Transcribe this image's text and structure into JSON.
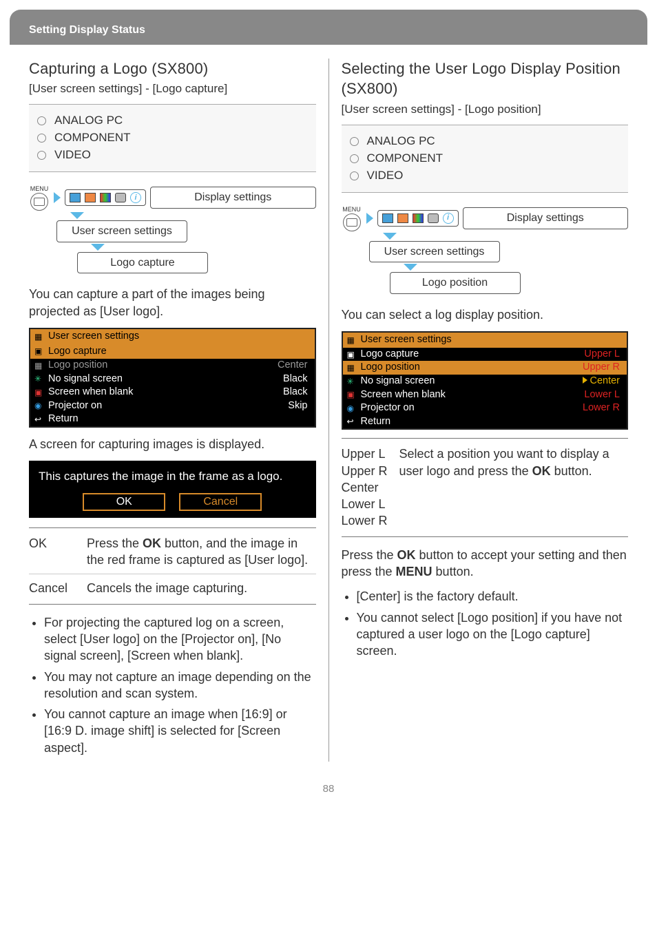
{
  "header": {
    "title": "Setting Display Status"
  },
  "left": {
    "title": "Capturing a Logo (SX800)",
    "path": "[User screen settings] - [Logo capture]",
    "sources": [
      "ANALOG PC",
      "COMPONENT",
      "VIDEO"
    ],
    "bc": {
      "menu": "MENU",
      "top": "Display settings",
      "mid": "User screen settings",
      "leaf": "Logo capture"
    },
    "para1": "You can capture a part of the images being projected as [User logo].",
    "ui1": {
      "header": "User screen settings",
      "sel": "Logo capture",
      "rows": [
        {
          "l": "Logo position",
          "r": "Center"
        },
        {
          "l": "No signal screen",
          "r": "Black"
        },
        {
          "l": "Screen when blank",
          "r": "Black"
        },
        {
          "l": "Projector on",
          "r": "Skip"
        }
      ],
      "return": "Return"
    },
    "para2": "A screen for capturing images is displayed.",
    "dialog": {
      "msg": "This captures the image in the frame as a logo.",
      "ok": "OK",
      "cancel": "Cancel"
    },
    "defs": {
      "ok": {
        "k": "OK",
        "v1": "Press the ",
        "v2": "OK",
        "v3": " button, and the image in the red frame is captured as [User logo]."
      },
      "cancel": {
        "k": "Cancel",
        "v": "Cancels the image capturing."
      }
    },
    "bullets": [
      "For projecting the captured log on a screen, select [User logo] on the [Projector on], [No signal screen], [Screen when blank].",
      "You may not capture an image depending on the resolution and scan system.",
      "You cannot capture an image when [16:9] or [16:9 D. image shift] is selected for [Screen aspect]."
    ]
  },
  "right": {
    "title": "Selecting the User Logo Display Position (SX800)",
    "path": "[User screen settings] - [Logo position]",
    "sources": [
      "ANALOG PC",
      "COMPONENT",
      "VIDEO"
    ],
    "bc": {
      "menu": "MENU",
      "top": "Display settings",
      "mid": "User screen settings",
      "leaf": "Logo position"
    },
    "para1": "You can select a log display position.",
    "ui1": {
      "header": "User screen settings",
      "rows": [
        {
          "l": "Logo capture",
          "r": ""
        },
        {
          "l": "Logo position",
          "r": "",
          "sel": true
        },
        {
          "l": "No signal screen",
          "r": ""
        },
        {
          "l": "Screen when blank",
          "r": ""
        },
        {
          "l": "Projector on",
          "r": ""
        }
      ],
      "opts": [
        "Upper L",
        "Upper R",
        "Center",
        "Lower L",
        "Lower R"
      ],
      "selOpt": "Center",
      "return": "Return"
    },
    "defs": {
      "keys": [
        "Upper L",
        "Upper R",
        "Center",
        "Lower L",
        "Lower R"
      ],
      "v1": "Select a position you want to display a user logo and press the ",
      "v2": "OK",
      "v3": " button."
    },
    "para2a": "Press the ",
    "para2b": "OK",
    "para2c": " button to accept your setting and then press the ",
    "para2d": "MENU",
    "para2e": " button.",
    "bullets": [
      "[Center] is the factory default.",
      "You cannot select [Logo position] if you have not captured a user logo on the [Logo capture] screen."
    ]
  },
  "page": "88"
}
